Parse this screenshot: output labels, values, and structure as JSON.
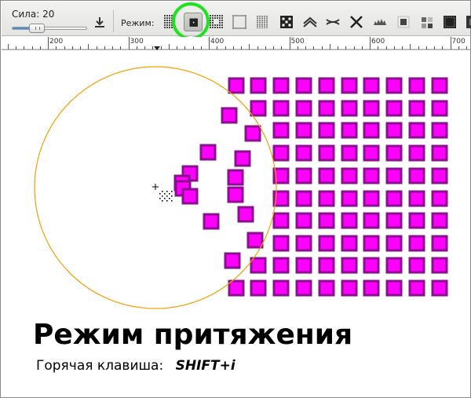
{
  "toolbar": {
    "strength_label": "Сила:",
    "strength_value": "20",
    "strength_fraction": 0.2,
    "mode_label": "Режим:",
    "modes": [
      {
        "name": "move-mode-icon",
        "active": false
      },
      {
        "name": "attract-mode-icon",
        "active": true
      },
      {
        "name": "repel-mode-icon",
        "active": false
      },
      {
        "name": "shrink-mode-icon",
        "active": false
      },
      {
        "name": "grow-mode-icon",
        "active": false
      },
      {
        "name": "jitter-mode-icon",
        "active": false
      },
      {
        "name": "rotate-mode-icon",
        "active": false
      },
      {
        "name": "scale-mode-icon",
        "active": false
      },
      {
        "name": "push-path-mode-icon",
        "active": false
      },
      {
        "name": "shrink-path-mode-icon",
        "active": false
      },
      {
        "name": "roughen-path-mode-icon",
        "active": false
      },
      {
        "name": "paint-mode-icon",
        "active": false
      },
      {
        "name": "jitter-color-mode-icon",
        "active": false
      },
      {
        "name": "blur-mode-icon",
        "active": false
      }
    ],
    "highlight_color": "#1ee21e"
  },
  "ruler": {
    "labels": [
      "200",
      "300",
      "400",
      "500",
      "600",
      "700"
    ]
  },
  "canvas": {
    "object_fill": "#ff00ff",
    "object_stroke": "#8a1090",
    "brush_circle_color": "#f5a000"
  },
  "hint": {
    "title": "Режим притяжения",
    "shortcut_label": "Горячая клавиша:",
    "shortcut_keys": "SHIFT+i"
  }
}
